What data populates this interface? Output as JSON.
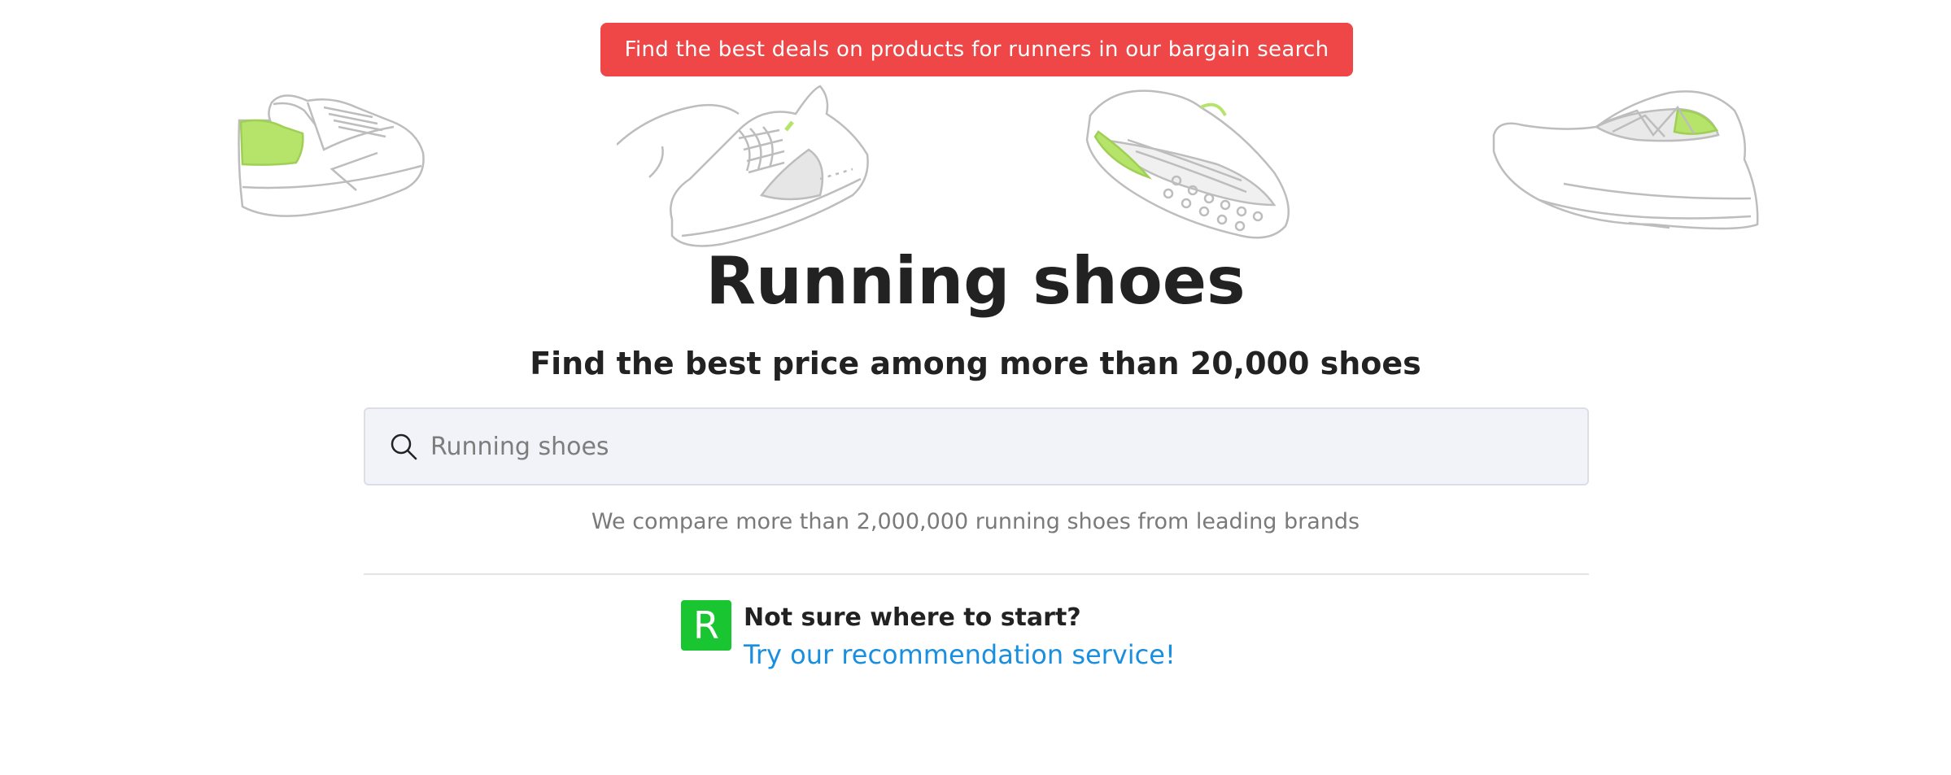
{
  "banner": {
    "text": "Find the best deals on products for runners in our bargain search"
  },
  "shoes": [
    {
      "icon": "running-shoe-heel-icon"
    },
    {
      "icon": "running-shoe-laces-icon"
    },
    {
      "icon": "running-shoe-sole-icon"
    },
    {
      "icon": "running-shoe-side-icon"
    }
  ],
  "hero": {
    "title": "Running shoes",
    "subtitle": "Find the best price among more than 20,000 shoes"
  },
  "search": {
    "placeholder": "Running shoes",
    "value": "",
    "icon": "search-icon"
  },
  "compare_text": "We compare more than 2,000,000 running shoes from leading brands",
  "recommendation": {
    "logo_letter": "R",
    "heading": "Not sure where to start?",
    "link_text": "Try our recommendation service!"
  },
  "colors": {
    "banner": "#ef4747",
    "accent_green": "#b6e46a",
    "logo_green": "#19c531",
    "link_blue": "#1a8fe0"
  }
}
